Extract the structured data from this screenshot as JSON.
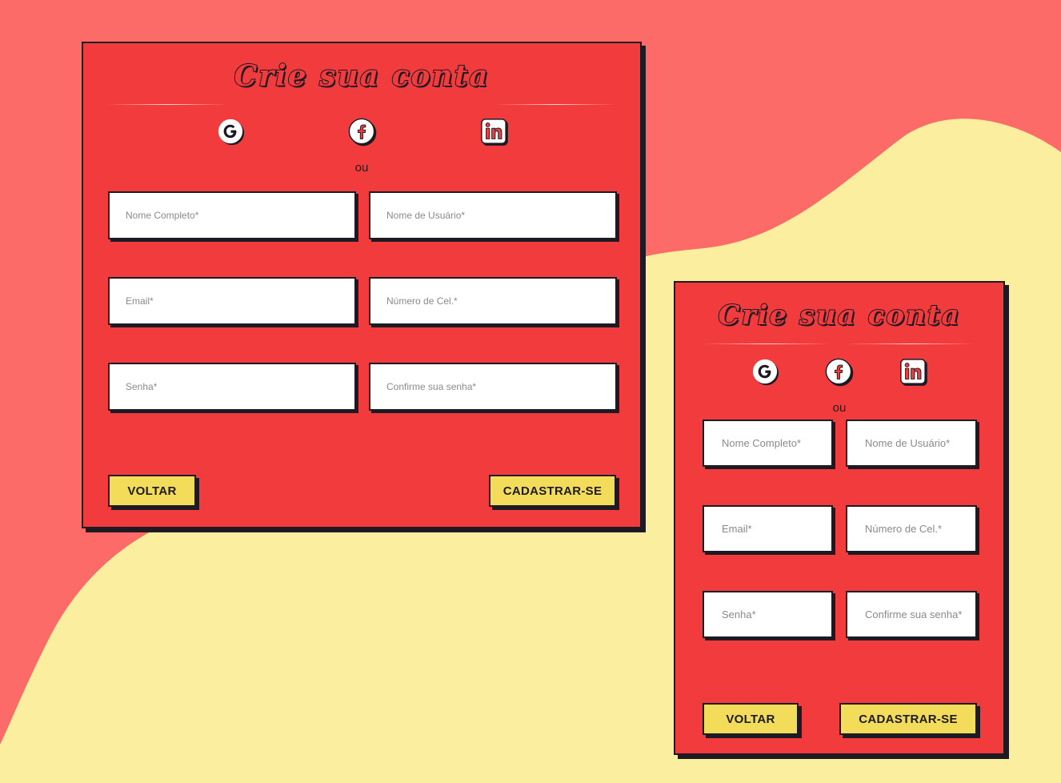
{
  "colors": {
    "background_red": "#fd6b69",
    "background_yellow": "#fbee9f",
    "card": "#f23b3d",
    "ink": "#1e1a24",
    "button": "#f3dc5a"
  },
  "forms": [
    {
      "title": "Crie sua conta",
      "social": [
        {
          "icon": "google-icon"
        },
        {
          "icon": "facebook-icon"
        },
        {
          "icon": "linkedin-icon"
        }
      ],
      "separator": "ou",
      "fields": {
        "full_name": "Nome Completo*",
        "username": "Nome de Usuário*",
        "email": "Email*",
        "phone": "Número de Cel.*",
        "password": "Senha*",
        "confirm_password": "Confirme sua senha*"
      },
      "buttons": {
        "back": "VOLTAR",
        "submit": "CADASTRAR-SE"
      }
    },
    {
      "title": "Crie sua conta",
      "social": [
        {
          "icon": "google-icon"
        },
        {
          "icon": "facebook-icon"
        },
        {
          "icon": "linkedin-icon"
        }
      ],
      "separator": "ou",
      "fields": {
        "full_name": "Nome Completo*",
        "username": "Nome de Usuário*",
        "email": "Email*",
        "phone": "Número de Cel.*",
        "password": "Senha*",
        "confirm_password": "Confirme sua senha*"
      },
      "buttons": {
        "back": "VOLTAR",
        "submit": "CADASTRAR-SE"
      }
    }
  ]
}
